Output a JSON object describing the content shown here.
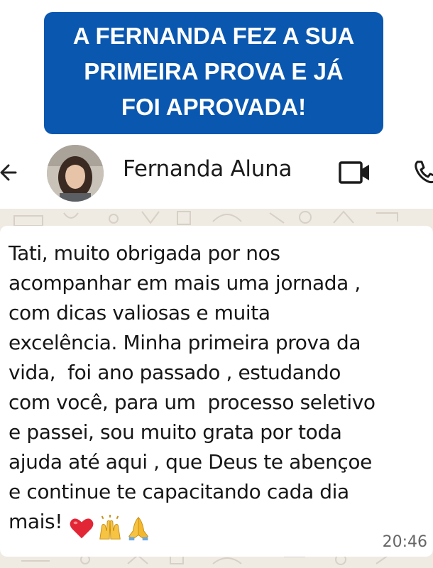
{
  "banner": {
    "line1": "A FERNANDA FEZ A SUA",
    "line2": "PRIMEIRA PROVA E JÁ",
    "line3": "FOI APROVADA!",
    "background": "#0a57b0"
  },
  "chat_header": {
    "contact_name": "Fernanda Aluna",
    "icons": [
      "back-arrow-icon",
      "video-call-icon",
      "phone-icon"
    ]
  },
  "message": {
    "text": "Tati, muito obrigada por nos\nacompanhar em mais uma jornada ,\ncom dicas valiosas e muita\nexcelência. Minha primeira prova da\nvida,  foi ano passado , estudando\ncom você, para um  processo seletivo\ne passei, sou muito grata por toda\najuda até aqui , que Deus te abençoe\ne continue te capacitando cada dia\nmais!",
    "emojis": [
      "heart-emoji",
      "raising-hands-emoji",
      "folded-hands-emoji"
    ],
    "time": "20:46"
  },
  "colors": {
    "chat_background": "#efeae2",
    "bubble": "#ffffff"
  }
}
